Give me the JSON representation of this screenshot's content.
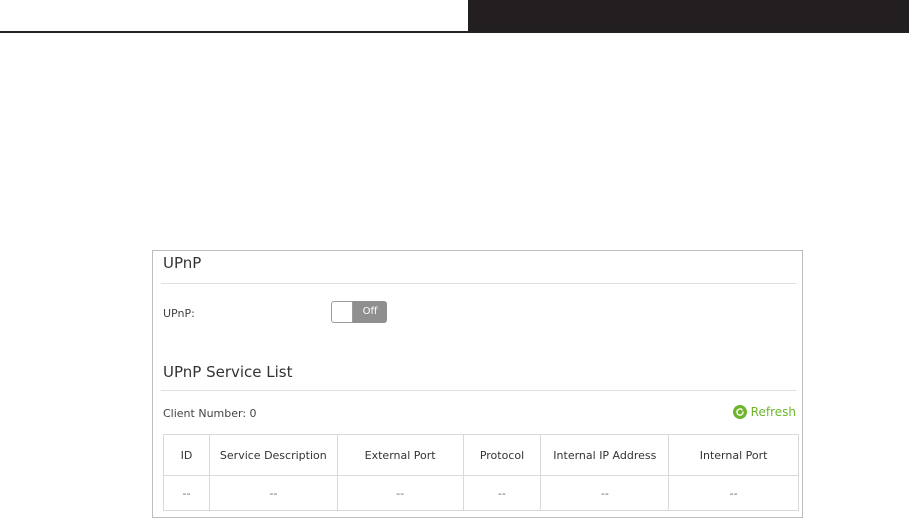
{
  "upnp_section": {
    "title": "UPnP",
    "field_label": "UPnP:",
    "toggle_state": "Off"
  },
  "service_list": {
    "title": "UPnP Service List",
    "client_number_label": "Client Number: 0",
    "refresh_label": "Refresh",
    "refresh_icon": "refresh-icon",
    "accent_color": "#6fb62c",
    "columns": [
      "ID",
      "Service Description",
      "External Port",
      "Protocol",
      "Internal IP Address",
      "Internal Port"
    ],
    "rows": [
      [
        "--",
        "--",
        "--",
        "--",
        "--",
        "--"
      ]
    ]
  }
}
